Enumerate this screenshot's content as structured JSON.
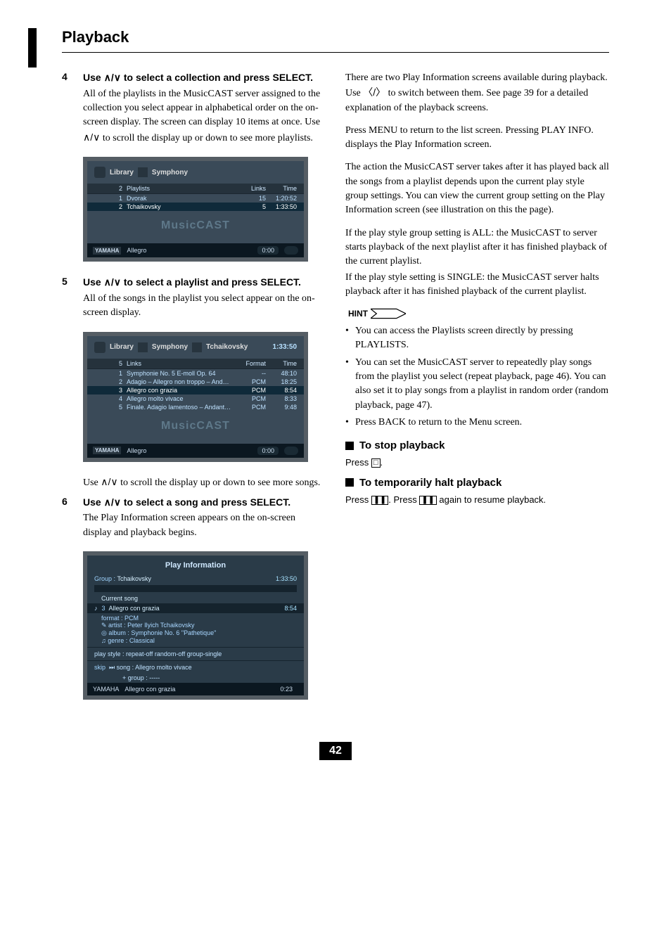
{
  "page": {
    "section_title": "Playback",
    "number": "42"
  },
  "steps": {
    "s4": {
      "num": "4",
      "head_pre": "Use ",
      "head_post": " to select a collection and press SELECT.",
      "glyph": "＾/＿",
      "body1": "All of the playlists in the MusicCAST server assigned to the collection you select appear in alphabetical order on the on-screen display. The screen can display 10 items at once. Use ",
      "body1_glyph": "＾/＿",
      "body1_tail": " to scroll the display up or down to see more playlists."
    },
    "s5": {
      "num": "5",
      "head_pre": "Use ",
      "head_post": " to select a playlist and press SELECT.",
      "glyph": "＾/＿",
      "body1": "All of the songs in the playlist you select appear on the on-screen display.",
      "note_pre": "Use ",
      "note_glyph": "＾/＿",
      "note_post": " to scroll the display up or down to see more songs."
    },
    "s6": {
      "num": "6",
      "head_pre": "Use ",
      "head_post": " to select a song and press SELECT.",
      "glyph": "＾/＿",
      "body1": "The Play Information screen appears on the on-screen display and playback begins."
    }
  },
  "fig1": {
    "breadcrumb1": "Library",
    "breadcrumb2": "Symphony",
    "head_count": "2",
    "head_name": "Playlists",
    "head_col3": "Links",
    "head_col4": "Time",
    "rows": [
      {
        "n": "1",
        "name": "Dvorak",
        "links": "15",
        "time": "1:20:52",
        "sel": false
      },
      {
        "n": "2",
        "name": "Tchaikovsky",
        "links": "5",
        "time": "1:33:50",
        "sel": true
      }
    ],
    "watermark": "MusicCAST",
    "footer_brand": "YAMAHA",
    "footer_track": "Allegro",
    "footer_time": "0:00"
  },
  "fig2": {
    "breadcrumb1": "Library",
    "breadcrumb2": "Symphony",
    "breadcrumb3": "Tchaikovsky",
    "toptime": "1:33:50",
    "head_count": "5",
    "head_name": "Links",
    "head_col3": "Format",
    "head_col4": "Time",
    "rows": [
      {
        "n": "1",
        "name": "Symphonie No. 5 E-moll Op. 64",
        "fmt": "--",
        "time": "48:10",
        "sel": false
      },
      {
        "n": "2",
        "name": "Adagio – Allegro non troppo – And…",
        "fmt": "PCM",
        "time": "18:25",
        "sel": false
      },
      {
        "n": "3",
        "name": "Allegro con grazia",
        "fmt": "PCM",
        "time": "8:54",
        "sel": true
      },
      {
        "n": "4",
        "name": "Allegro molto vivace",
        "fmt": "PCM",
        "time": "8:33",
        "sel": false
      },
      {
        "n": "5",
        "name": "Finale. Adagio lamentoso – Andant…",
        "fmt": "PCM",
        "time": "9:48",
        "sel": false
      }
    ],
    "watermark": "MusicCAST",
    "footer_brand": "YAMAHA",
    "footer_track": "Allegro",
    "footer_time": "0:00"
  },
  "fig3": {
    "title": "Play Information",
    "group_label": "Group :",
    "group_value": "Tchaikovsky",
    "toptime": "1:33:50",
    "current_label": "Current song",
    "track_no": "3",
    "track_name": "Allegro con grazia",
    "track_time": "8:54",
    "format_label": "format :",
    "format_value": "PCM",
    "artist_label": "artist :",
    "artist_value": "Peter Ilyich Tchaikovsky",
    "album_label": "album :",
    "album_value": "Symphonie No. 6 \"Pathetique\"",
    "genre_label": "genre :",
    "genre_value": "Classical",
    "playstyle": "play style : repeat-off     random-off     group-single",
    "skip_label": "skip",
    "skip_song": "song : Allegro molto vivace",
    "skip_group": "+ group : -----",
    "footer_brand": "YAMAHA",
    "footer_track": "Allegro con grazia",
    "footer_time": "0:23"
  },
  "right": {
    "p1a": "There are two Play Information screens available during playback. Use ",
    "p1b": " to switch between them. See page 39 for a detailed explanation of the playback screens.",
    "p1_glyph": "〈/〉",
    "p2": "Press MENU to return to the list screen. Pressing PLAY INFO. displays the Play Information screen.",
    "p3": "The action the MusicCAST server takes after it has played back all the songs from a playlist depends upon the current play style group settings. You can view the current group setting on the Play Information screen (see illustration on this the page).",
    "p4": "If the play style group setting is ALL: the MusicCAST to server starts playback of the next playlist after it has finished playback of the current playlist.",
    "p5": "If the play style setting is SINGLE: the MusicCAST server halts playback after it has finished playback of the current playlist.",
    "hint_label": "HINT",
    "hints": [
      "You can access the Playlists screen directly by pressing PLAYLISTS.",
      "You can set the MusicCAST server to repeatedly play songs from the playlist you select (repeat playback, page 46). You can also set it to play songs from a playlist in random order (random playback, page 47).",
      "Press BACK to return to the Menu screen."
    ],
    "stop_head": "To stop playback",
    "stop_body_pre": "Press ",
    "stop_body_post": ".",
    "pause_head": "To temporarily halt playback",
    "pause_body_a": "Press ",
    "pause_body_b": ". Press ",
    "pause_body_c": " again to resume playback."
  }
}
